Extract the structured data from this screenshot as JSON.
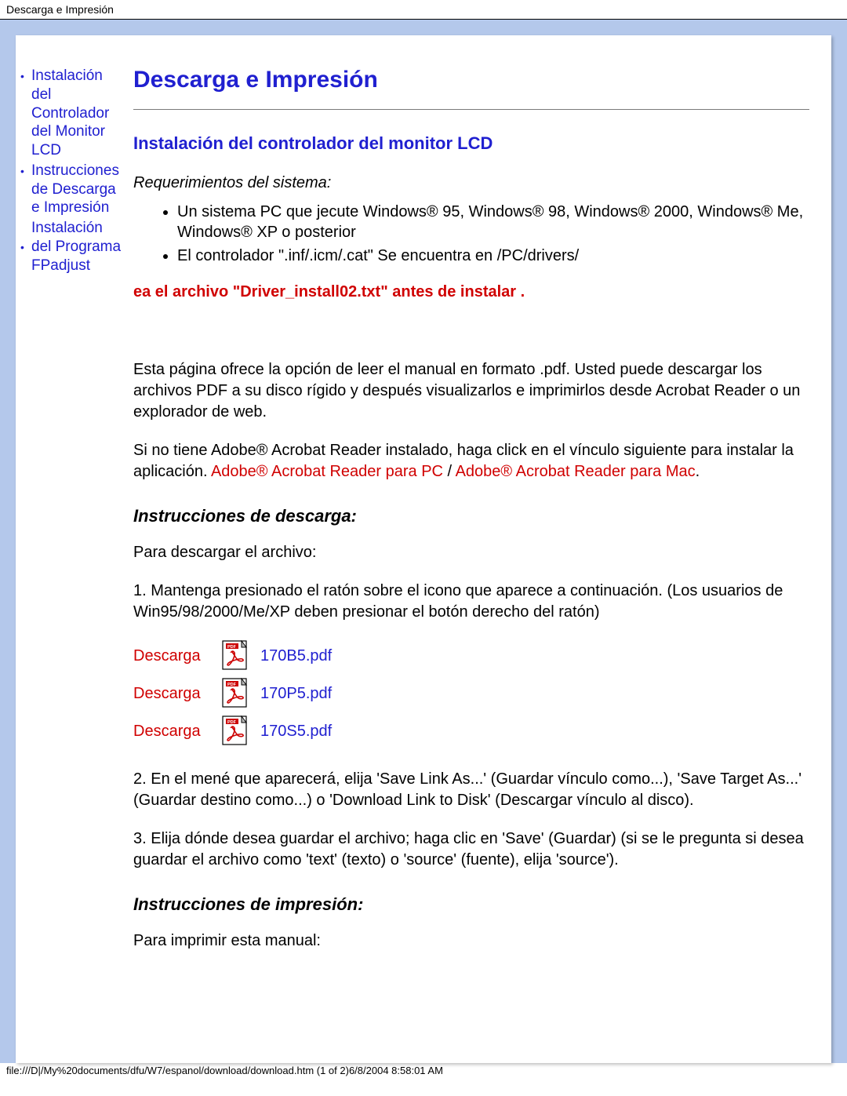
{
  "header": "Descarga e Impresión",
  "sidebar": {
    "items": [
      {
        "label": "Instalación del Controlador del Monitor LCD"
      },
      {
        "label": "Instrucciones de Descarga e Impresión"
      },
      {
        "label": "Instalación del Programa FPadjust"
      }
    ]
  },
  "title": "Descarga e Impresión",
  "section_install_title": "Instalación del controlador del monitor LCD",
  "req_label": "Requerimientos del sistema:",
  "reqs": [
    "Un sistema PC que jecute Windows® 95, Windows® 98, Windows® 2000, Windows® Me, Windows® XP o posterior",
    "El controlador \".inf/.icm/.cat\" Se encuentra en /PC/drivers/"
  ],
  "red_notice": "ea el archivo \"Driver_install02.txt\" antes de instalar .",
  "para_pdf_intro": "Esta página ofrece la opción de leer el manual en formato .pdf. Usted puede descargar los archivos PDF a su disco rígido y después visualizarlos e imprimirlos desde Acrobat Reader o un explorador de web.",
  "para_adobe_pre": "Si no tiene Adobe® Acrobat Reader instalado, haga click en el vínculo siguiente para instalar la aplicación. ",
  "adobe_pc": "Adobe® Acrobat Reader para PC",
  "adobe_sep": " / ",
  "adobe_mac": "Adobe® Acrobat Reader para Mac",
  "adobe_end": ".",
  "sub_download": "Instrucciones de descarga:",
  "para_download_intro": "Para descargar el archivo:",
  "para_step1": "1. Mantenga presionado el ratón sobre el icono que aparece a continuación. (Los usuarios de Win95/98/2000/Me/XP deben presionar el botón derecho del ratón)",
  "descarga_label": "Descarga",
  "downloads": [
    {
      "file": "170B5.pdf"
    },
    {
      "file": "170P5.pdf"
    },
    {
      "file": "170S5.pdf"
    }
  ],
  "para_step2": "2. En el mené que aparecerá, elija 'Save Link As...' (Guardar vínculo como...), 'Save Target As...' (Guardar destino como...) o 'Download Link to Disk' (Descargar vínculo al disco).",
  "para_step3": "3. Elija dónde desea guardar el archivo; haga clic en 'Save' (Guardar) (si se le pregunta si desea guardar el archivo como 'text' (texto) o 'source' (fuente), elija 'source').",
  "sub_print": "Instrucciones de impresión:",
  "para_print_intro": "Para imprimir esta manual:",
  "footer": "file:///D|/My%20documents/dfu/W7/espanol/download/download.htm (1 of 2)6/8/2004 8:58:01 AM"
}
